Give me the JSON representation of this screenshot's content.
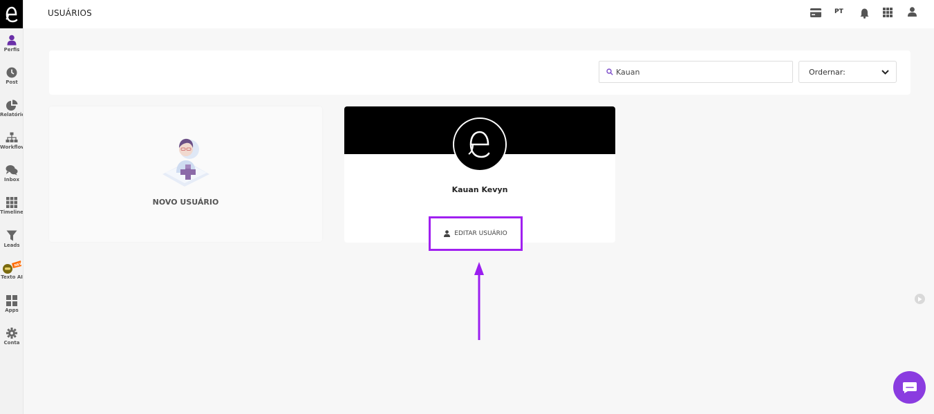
{
  "app": {
    "brand_letter": "e"
  },
  "header": {
    "title": "USUÁRIOS",
    "language": "PT",
    "icons": [
      "credit-card-icon",
      "bell-icon",
      "grid-icon",
      "user-icon"
    ]
  },
  "sidebar": {
    "items": [
      {
        "label": "Perfis",
        "icon": "user-icon",
        "active": true
      },
      {
        "label": "Post",
        "icon": "clock-icon"
      },
      {
        "label": "Relatórios",
        "icon": "pie-chart-icon"
      },
      {
        "label": "Workflows",
        "icon": "sitemap-icon"
      },
      {
        "label": "Inbox",
        "icon": "chat-icon"
      },
      {
        "label": "Timeline",
        "icon": "grid-icon"
      },
      {
        "label": "Leads",
        "icon": "filter-icon"
      },
      {
        "label": "Texto AI",
        "icon": "robot-icon",
        "badge": "NEW"
      },
      {
        "label": "Apps",
        "icon": "apps-icon"
      },
      {
        "label": "Conta",
        "icon": "gear-icon"
      }
    ]
  },
  "filter": {
    "search_value": "Kauan",
    "order_label": "Ordernar:"
  },
  "cards": {
    "new_user_label": "NOVO USUÁRIO",
    "user": {
      "name": "Kauan Kevyn",
      "edit_label": "EDITAR USUÁRIO"
    }
  },
  "colors": {
    "accent": "#8a3ce0",
    "highlight": "#a020f0",
    "banner": "#000000"
  }
}
